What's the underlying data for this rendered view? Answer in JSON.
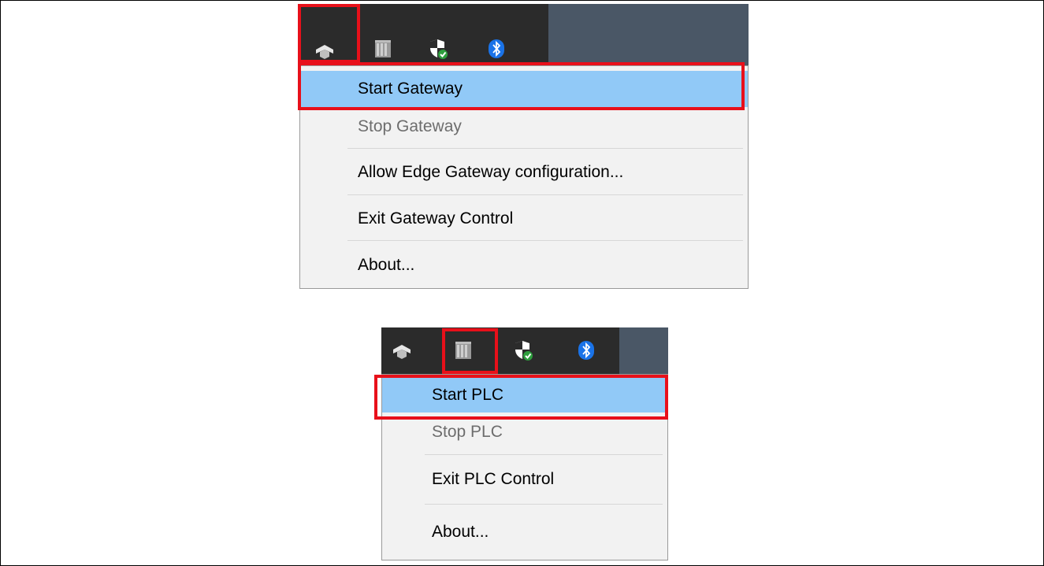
{
  "gateway_panel": {
    "tray_icons": [
      "gateway-icon",
      "plc-icon",
      "security-shield-icon",
      "bluetooth-icon"
    ],
    "menu_items": [
      {
        "label": "Start Gateway",
        "state": "highlighted"
      },
      {
        "label": "Stop Gateway",
        "state": "disabled"
      },
      {
        "label": "Allow Edge Gateway configuration...",
        "state": "normal"
      },
      {
        "label": "Exit Gateway Control",
        "state": "normal"
      },
      {
        "label": "About...",
        "state": "normal"
      }
    ]
  },
  "plc_panel": {
    "tray_icons": [
      "gateway-icon",
      "plc-icon",
      "security-shield-icon",
      "bluetooth-icon"
    ],
    "menu_items": [
      {
        "label": "Start PLC",
        "state": "highlighted"
      },
      {
        "label": "Stop PLC",
        "state": "disabled"
      },
      {
        "label": "Exit PLC Control",
        "state": "normal"
      },
      {
        "label": "About...",
        "state": "normal"
      }
    ]
  },
  "colors": {
    "highlight": "#91c9f7",
    "annotation_red": "#e8101a",
    "taskbar": "#2b2b2b",
    "bluetooth": "#1a73e8",
    "shield_check": "#2e9e3e"
  }
}
